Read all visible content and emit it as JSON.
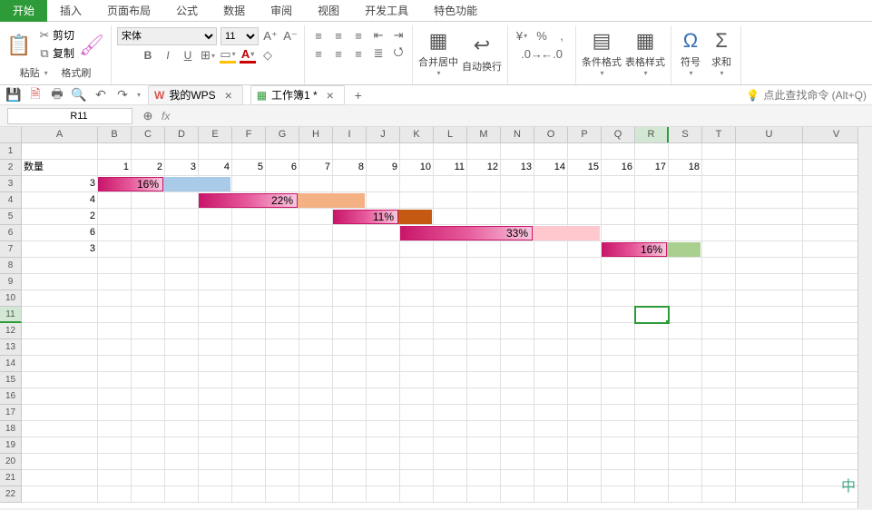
{
  "menu": {
    "tabs": [
      "开始",
      "插入",
      "页面布局",
      "公式",
      "数据",
      "审阅",
      "视图",
      "开发工具",
      "特色功能"
    ]
  },
  "ribbon": {
    "paste": "粘贴",
    "cut": "剪切",
    "copy": "复制",
    "format_painter": "格式刷",
    "font_name": "宋体",
    "font_size": "11",
    "merge": "合并居中",
    "wrap": "自动换行",
    "cond_fmt": "条件格式",
    "table_style": "表格样式",
    "symbol": "符号",
    "sum": "求和",
    "pct": "%"
  },
  "qat": {
    "help": "点此查找命令 (Alt+Q)"
  },
  "tabs": {
    "wps": "我的WPS",
    "book": "工作簿1 *"
  },
  "namebox": "R11",
  "fx": "fx",
  "cols": [
    "A",
    "B",
    "C",
    "D",
    "E",
    "F",
    "G",
    "H",
    "I",
    "J",
    "K",
    "L",
    "M",
    "N",
    "O",
    "P",
    "Q",
    "R",
    "S",
    "T",
    "U",
    "V"
  ],
  "data": {
    "a2": "数量",
    "r2": [
      "1",
      "2",
      "3",
      "4",
      "5",
      "6",
      "7",
      "8",
      "9",
      "10",
      "11",
      "12",
      "13",
      "14",
      "15",
      "16",
      "17",
      "18"
    ],
    "a": [
      "3",
      "4",
      "2",
      "6",
      "3"
    ]
  },
  "chart_data": {
    "type": "bar",
    "orientation": "horizontal-stacked-span",
    "title": "数量",
    "xlim": [
      1,
      18
    ],
    "series": [
      {
        "name": "row3",
        "start": 1,
        "value_end": 3,
        "label": "16%",
        "extent_end": 5,
        "color": "#e75a9b",
        "extent_color": "#a9cbe8"
      },
      {
        "name": "row4",
        "start": 4,
        "value_end": 7,
        "label": "22%",
        "extent_end": 9,
        "color": "#e75a9b",
        "extent_color": "#f4b183"
      },
      {
        "name": "row5",
        "start": 8,
        "value_end": 10,
        "label": "11%",
        "extent_end": 11,
        "color": "#e75a9b",
        "extent_color": "#c65911"
      },
      {
        "name": "row6",
        "start": 10,
        "value_end": 14,
        "label": "33%",
        "extent_end": 16,
        "color": "#e75a9b",
        "extent_color": "#ffc7ce"
      },
      {
        "name": "row7",
        "start": 16,
        "value_end": 18,
        "label": "16%",
        "extent_end": 19,
        "color": "#e75a9b",
        "extent_color": "#a9d08e"
      }
    ]
  },
  "ime": "中"
}
